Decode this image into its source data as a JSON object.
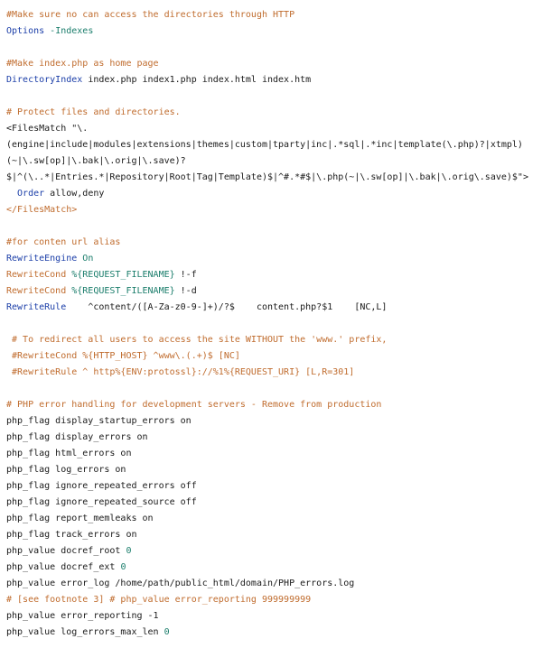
{
  "colors": {
    "comment": "#c06c2e",
    "directive": "#1b3ea8",
    "value": "#1a7d6b",
    "text": "#1a1a1a",
    "background": "#ffffff"
  },
  "lines": [
    [
      {
        "t": "#Make sure no can access the directories through HTTP",
        "c": "c"
      }
    ],
    [
      {
        "t": "Options ",
        "c": "k"
      },
      {
        "t": "-Indexes",
        "c": "v"
      }
    ],
    [],
    [
      {
        "t": "#Make index.php as home page",
        "c": "c"
      }
    ],
    [
      {
        "t": "DirectoryIndex",
        "c": "k"
      },
      {
        "t": " index.php index1.php index.html index.htm",
        "c": "n"
      }
    ],
    [],
    [
      {
        "t": "# Protect files and directories.",
        "c": "c"
      }
    ],
    [
      {
        "t": "<FilesMatch \"\\.",
        "c": "n"
      }
    ],
    [
      {
        "t": "(engine|include|modules|extensions|themes|custom|tparty|inc|.*sql|.*inc|template(\\.php)?|xtmpl)",
        "c": "n"
      }
    ],
    [
      {
        "t": "(~|\\.sw[op]|\\.bak|\\.orig|\\.save)?",
        "c": "n"
      }
    ],
    [
      {
        "t": "$|^(\\..*|Entries.*|Repository|Root|Tag|Template)$|^#.*#$|\\.php(~|\\.sw[op]|\\.bak|\\.orig\\.save)$\">",
        "c": "n"
      }
    ],
    [
      {
        "t": "  Order",
        "c": "k"
      },
      {
        "t": " allow,deny",
        "c": "n"
      }
    ],
    [
      {
        "t": "</FilesMatch>",
        "c": "c"
      }
    ],
    [],
    [
      {
        "t": "#for conten url alias",
        "c": "c"
      }
    ],
    [
      {
        "t": "RewriteEngine ",
        "c": "k"
      },
      {
        "t": "On",
        "c": "v"
      }
    ],
    [
      {
        "t": "RewriteCond ",
        "c": "c"
      },
      {
        "t": "%{REQUEST_FILENAME}",
        "c": "v"
      },
      {
        "t": " !-f",
        "c": "n"
      }
    ],
    [
      {
        "t": "RewriteCond ",
        "c": "c"
      },
      {
        "t": "%{REQUEST_FILENAME}",
        "c": "v"
      },
      {
        "t": " !-d",
        "c": "n"
      }
    ],
    [
      {
        "t": "RewriteRule",
        "c": "k"
      },
      {
        "t": "    ^content/([A-Za-z0-9-]+)/?$    content.php?$1    [NC,L]",
        "c": "n"
      }
    ],
    [],
    [
      {
        "t": " # To redirect all users to access the site WITHOUT the 'www.' prefix,",
        "c": "c"
      }
    ],
    [
      {
        "t": " #RewriteCond %{HTTP_HOST} ^www\\.(.+)$ [NC]",
        "c": "c"
      }
    ],
    [
      {
        "t": " #RewriteRule ^ http%{ENV:protossl}://%1%{REQUEST_URI} [L,R=301]",
        "c": "c"
      }
    ],
    [],
    [
      {
        "t": "# PHP error handling for development servers - Remove from production",
        "c": "c"
      }
    ],
    [
      {
        "t": "php_flag display_startup_errors on",
        "c": "n"
      }
    ],
    [
      {
        "t": "php_flag display_errors on",
        "c": "n"
      }
    ],
    [
      {
        "t": "php_flag html_errors on",
        "c": "n"
      }
    ],
    [
      {
        "t": "php_flag log_errors on",
        "c": "n"
      }
    ],
    [
      {
        "t": "php_flag ignore_repeated_errors off",
        "c": "n"
      }
    ],
    [
      {
        "t": "php_flag ignore_repeated_source off",
        "c": "n"
      }
    ],
    [
      {
        "t": "php_flag report_memleaks on",
        "c": "n"
      }
    ],
    [
      {
        "t": "php_flag track_errors on",
        "c": "n"
      }
    ],
    [
      {
        "t": "php_value docref_root ",
        "c": "n"
      },
      {
        "t": "0",
        "c": "v"
      }
    ],
    [
      {
        "t": "php_value docref_ext ",
        "c": "n"
      },
      {
        "t": "0",
        "c": "v"
      }
    ],
    [
      {
        "t": "php_value error_log /home/path/public_html/domain/PHP_errors.log",
        "c": "n"
      }
    ],
    [
      {
        "t": "# [see footnote 3] # php_value error_reporting 999999999",
        "c": "c"
      }
    ],
    [
      {
        "t": "php_value error_reporting -1",
        "c": "n"
      }
    ],
    [
      {
        "t": "php_value log_errors_max_len ",
        "c": "n"
      },
      {
        "t": "0",
        "c": "v"
      }
    ]
  ]
}
